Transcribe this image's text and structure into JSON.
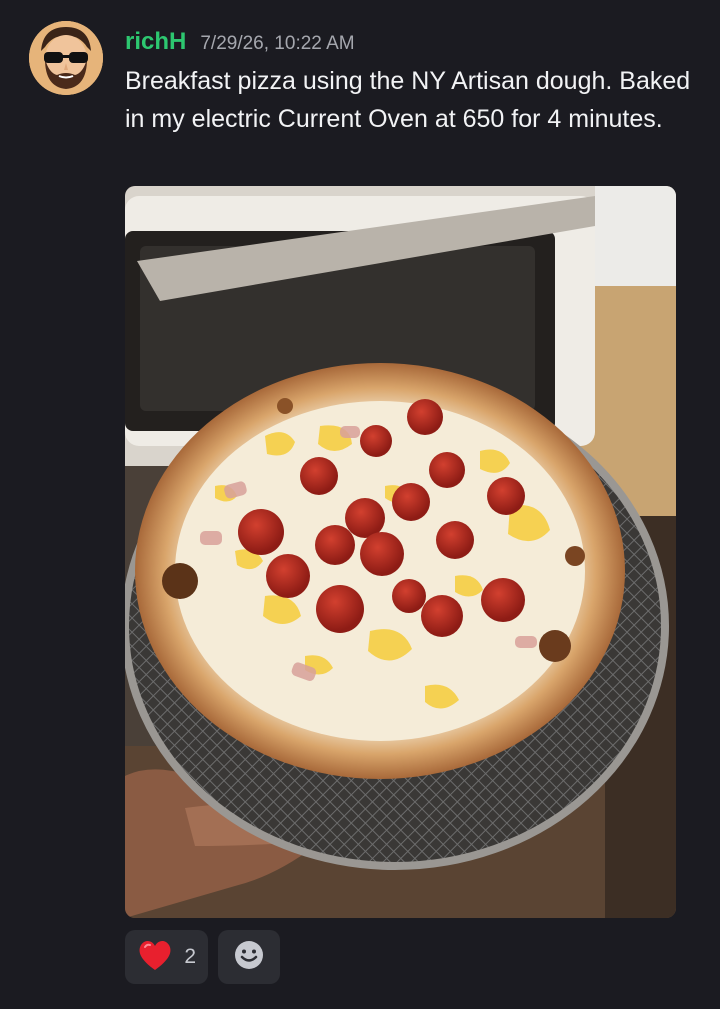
{
  "message": {
    "username": "richH",
    "timestamp": "7/29/26, 10:22 AM",
    "text": "Breakfast pizza using the NY Artisan dough. Baked in my electric Current Oven at 650 for 4 minutes.",
    "username_color": "#2dc770"
  },
  "avatar": {
    "icon": "bearded-man-sunglasses-avatar"
  },
  "attachment": {
    "description_icon": "pizza-photo"
  },
  "reactions": [
    {
      "emoji": "red-heart-icon",
      "count": "2"
    }
  ],
  "add_reaction": {
    "icon": "smiley-add-reaction-icon"
  },
  "colors": {
    "background": "#1b1b21",
    "reaction_bg": "#2c2d33",
    "text": "#f2f3f5",
    "timestamp": "#a5a7ae"
  }
}
